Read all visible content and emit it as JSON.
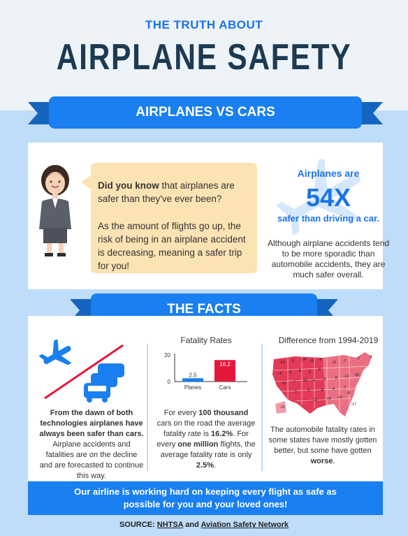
{
  "header": {
    "kicker": "THE TRUTH ABOUT",
    "title": "AIRPLANE SAFETY"
  },
  "section1": {
    "ribbon": "AIRPLANES VS CARS",
    "bubble": {
      "did_you_know": "Did you know",
      "line1_rest": " that airplanes are safer than they've ever been?",
      "line2": "As the amount of flights go up, the risk of being in an airplane accident is decreasing, meaning a safer trip for you!"
    },
    "stat": {
      "top": "Airplanes are",
      "big": "54X",
      "bottom": "safer than driving a car.",
      "note": "Although airplane accidents tend to be more sporadic than automobile accidents, they are much safer overall."
    }
  },
  "section2": {
    "ribbon": "THE FACTS",
    "col1": {
      "p1": "From the dawn of both technologies airplanes have always been safer than cars.",
      "p2": "Airplane accidents and fatalities are on the decline and are forecasted to continue this way."
    },
    "col2": {
      "t1": "For every ",
      "b1": "100 thousand",
      "t2": " cars on the road the average fatality rate is ",
      "b2": "16.2%",
      "t3": ". For every ",
      "b3": "one million",
      "t4": " flights, the average fatality rate is only ",
      "b4": "2.5%",
      "t5": "."
    },
    "col3": {
      "title": "Difference from 1994-2019",
      "t1": "The automobile fatality rates in some states have mostly gotten better, but some have gotten ",
      "b1": "worse",
      "t2": "."
    }
  },
  "chart_data": {
    "type": "bar",
    "title": "Fatality Rates",
    "categories": [
      "Planes",
      "Cars"
    ],
    "values": [
      2.5,
      16.2
    ],
    "colors": [
      "#1a7ff0",
      "#e4173a"
    ],
    "ylim": [
      0,
      20
    ],
    "yticks": [
      "0",
      "20"
    ],
    "value_labels": [
      "2.5",
      "16.2"
    ]
  },
  "map": {
    "labels": [
      "-10",
      "-3",
      "-14",
      "-8",
      "-6",
      "-11",
      "-7",
      "-1",
      "-1",
      "-4",
      "-3",
      "-8",
      "-3",
      "-8",
      "-15",
      "-7",
      "-20",
      "-4",
      "-6",
      "-8",
      "-12",
      "-18",
      "5",
      "5",
      "-5",
      "-4",
      "-7",
      "13",
      "-14",
      "-16",
      "-21",
      "-8",
      "-17"
    ]
  },
  "footer": {
    "banner_line1": "Our airline is working hard on keeping every flight as safe as",
    "banner_line2": "possible for you and your loved ones!",
    "source_prefix": "SOURCE: ",
    "source1": "NHTSA",
    "source_and": " and ",
    "source2": "Aviation Safety Network"
  },
  "colors": {
    "accent_blue": "#1a7ff0",
    "title_navy": "#1c3a52",
    "bubble": "#fce3b4",
    "bg_light_blue": "#bfdcf8",
    "cars_red": "#e4173a",
    "map_red": "#e23a57"
  }
}
